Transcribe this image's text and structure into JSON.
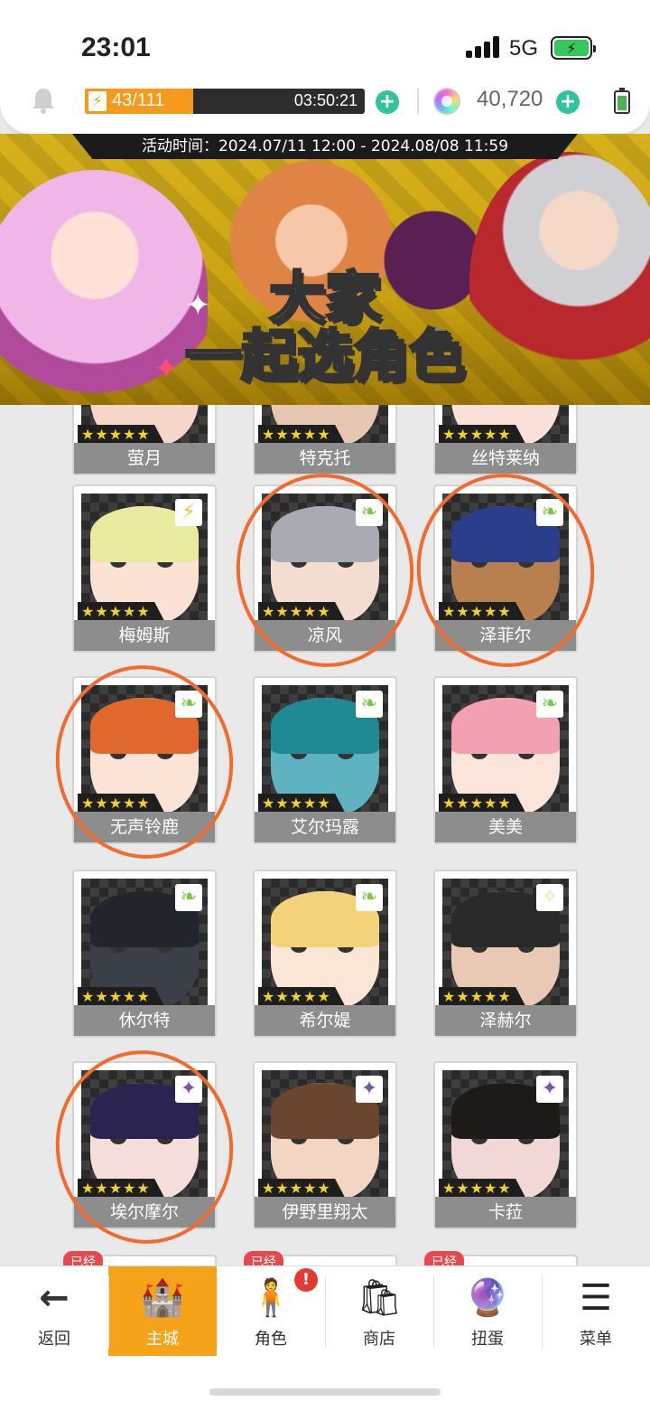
{
  "status_bar": {
    "time": "23:01",
    "network": "5G",
    "battery_glyph": "⚡"
  },
  "resources": {
    "energy_current": "43/111",
    "energy_fraction": 0.387,
    "energy_timer": "03:50:21",
    "gems": "40,720"
  },
  "banner": {
    "event_time": "活动时间：2024.07/11 12:00 - 2024.08/08 11:59",
    "title_line1": "大家",
    "title_line2": "一起选角色"
  },
  "characters": [
    {
      "name": "萤月",
      "stars": "★★★★★",
      "element": "leaf",
      "hair": "#d9d9e8",
      "skin": "#f6d6c8",
      "row": 0,
      "col": 0,
      "circled": false
    },
    {
      "name": "特克托",
      "stars": "★★★★★",
      "element": "leaf",
      "hair": "#555",
      "skin": "#e6c6b0",
      "row": 0,
      "col": 1,
      "circled": false
    },
    {
      "name": "丝特莱纳",
      "stars": "★★★★★",
      "element": "leaf",
      "hair": "#f19bb0",
      "skin": "#f9e0d8",
      "row": 0,
      "col": 2,
      "circled": false
    },
    {
      "name": "梅姆斯",
      "stars": "★★★★★",
      "element": "bolt",
      "hair": "#e8eaa0",
      "skin": "#fbe2d5",
      "row": 1,
      "col": 0,
      "circled": false
    },
    {
      "name": "凉风",
      "stars": "★★★★★",
      "element": "leaf",
      "hair": "#a9abb3",
      "skin": "#f3ddd0",
      "row": 1,
      "col": 1,
      "circled": true
    },
    {
      "name": "泽菲尔",
      "stars": "★★★★★",
      "element": "leaf",
      "hair": "#2a3e8c",
      "skin": "#b9804f",
      "row": 1,
      "col": 2,
      "circled": true
    },
    {
      "name": "无声铃鹿",
      "stars": "★★★★★",
      "element": "leaf",
      "hair": "#e0672e",
      "skin": "#fbe3d6",
      "row": 2,
      "col": 0,
      "circled": true
    },
    {
      "name": "艾尔玛露",
      "stars": "★★★★★",
      "element": "leaf",
      "hair": "#1f8a96",
      "skin": "#5fb3c1",
      "row": 2,
      "col": 1,
      "circled": false
    },
    {
      "name": "美美",
      "stars": "★★★★★",
      "element": "leaf",
      "hair": "#f3a0b3",
      "skin": "#fbe5da",
      "row": 2,
      "col": 2,
      "circled": false
    },
    {
      "name": "休尔特",
      "stars": "★★★★★",
      "element": "leaf",
      "hair": "#22252b",
      "skin": "#3b3f47",
      "row": 3,
      "col": 0,
      "circled": false
    },
    {
      "name": "希尔媞",
      "stars": "★★★★★",
      "element": "leaf",
      "hair": "#f3d27a",
      "skin": "#fbe5d6",
      "row": 3,
      "col": 1,
      "circled": false
    },
    {
      "name": "泽赫尔",
      "stars": "★★★★★",
      "element": "light",
      "hair": "#2a2a2a",
      "skin": "#e9c9b3",
      "row": 3,
      "col": 2,
      "circled": false
    },
    {
      "name": "埃尔摩尔",
      "stars": "★★★★★",
      "element": "dark",
      "hair": "#2c2450",
      "skin": "#f6dedd",
      "row": 4,
      "col": 0,
      "circled": true
    },
    {
      "name": "伊野里翔太",
      "stars": "★★★★★",
      "element": "dark",
      "hair": "#6a4630",
      "skin": "#f3d5c3",
      "row": 4,
      "col": 1,
      "circled": false
    },
    {
      "name": "卡菈",
      "stars": "★★★★★",
      "element": "dark",
      "hair": "#1e1a1a",
      "skin": "#f1d8d6",
      "row": 4,
      "col": 2,
      "circled": false
    }
  ],
  "partial_row_tag": "已经",
  "nav": [
    {
      "label": "返回",
      "icon": "←",
      "icon_name": "back-arrow-icon",
      "active": false,
      "badge": ""
    },
    {
      "label": "主城",
      "icon": "🏰",
      "icon_name": "castle-icon",
      "active": true,
      "badge": ""
    },
    {
      "label": "角色",
      "icon": "🧍",
      "icon_name": "character-icon",
      "active": false,
      "badge": "!"
    },
    {
      "label": "商店",
      "icon": "🛍",
      "icon_name": "shop-icon",
      "active": false,
      "badge": ""
    },
    {
      "label": "扭蛋",
      "icon": "🔮",
      "icon_name": "gacha-icon",
      "active": false,
      "badge": ""
    },
    {
      "label": "菜单",
      "icon": "☰",
      "icon_name": "menu-icon",
      "active": false,
      "badge": ""
    }
  ],
  "colors": {
    "accent_orange": "#f5a319",
    "energy_orange": "#f59a1c",
    "plus_green": "#2fc49c",
    "annotation_orange": "#f26a2c"
  }
}
